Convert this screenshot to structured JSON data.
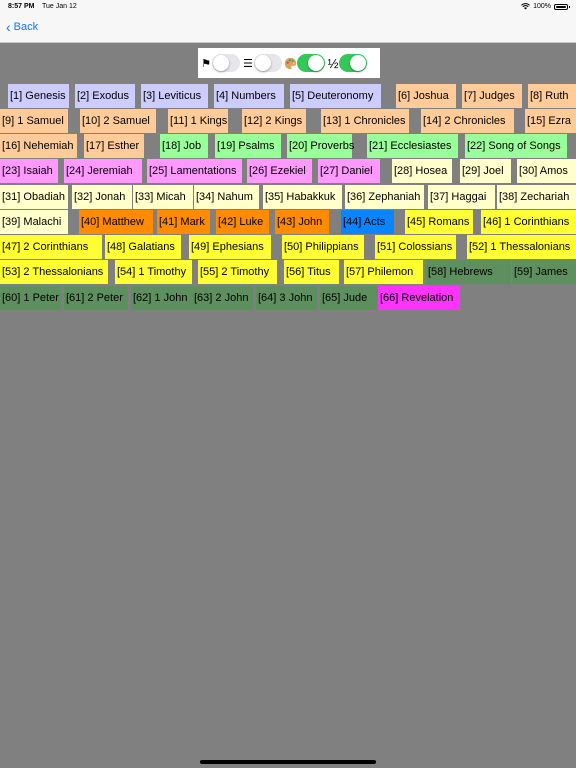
{
  "status": {
    "time": "8:57 PM",
    "date": "Tue Jan 12",
    "battery": "100%"
  },
  "nav": {
    "back_label": "Back"
  },
  "toggles": {
    "flag_glyph": "⚑",
    "list_glyph": "☰",
    "half_glyph": "½",
    "flag_on": false,
    "list_on": false,
    "palette_on": true,
    "half_on": true
  },
  "colors": {
    "law": "#ccccff",
    "history": "#ffcc99",
    "wisdom": "#99ff99",
    "prophets_major": "#ff99ff",
    "prophets_minor": "#ffffcc",
    "gospels": "#ff8c00",
    "acts": "#0a84ff",
    "epistles": "#ffff33",
    "general_epistles": "#5e8f5e",
    "revelation": "#ff33ff",
    "toggle_on": "#34c759",
    "link": "#0a7aff"
  },
  "books": [
    {
      "label": "[1] Genesis",
      "group": "law"
    },
    {
      "label": "[2] Exodus",
      "group": "law"
    },
    {
      "label": "[3] Leviticus",
      "group": "law"
    },
    {
      "label": "[4] Numbers",
      "group": "law"
    },
    {
      "label": "[5] Deuteronomy",
      "group": "law"
    },
    {
      "label": "[6] Joshua",
      "group": "history"
    },
    {
      "label": "[7] Judges",
      "group": "history"
    },
    {
      "label": "[8] Ruth",
      "group": "history"
    },
    {
      "label": "[9] 1 Samuel",
      "group": "history"
    },
    {
      "label": "[10] 2 Samuel",
      "group": "history"
    },
    {
      "label": "[11] 1 Kings",
      "group": "history"
    },
    {
      "label": "[12] 2 Kings",
      "group": "history"
    },
    {
      "label": "[13] 1 Chronicles",
      "group": "history"
    },
    {
      "label": "[14] 2 Chronicles",
      "group": "history"
    },
    {
      "label": "[15] Ezra",
      "group": "history"
    },
    {
      "label": "[16] Nehemiah",
      "group": "history"
    },
    {
      "label": "[17] Esther",
      "group": "history"
    },
    {
      "label": "[18] Job",
      "group": "wisdom"
    },
    {
      "label": "[19] Psalms",
      "group": "wisdom"
    },
    {
      "label": "[20] Proverbs",
      "group": "wisdom"
    },
    {
      "label": "[21] Ecclesiastes",
      "group": "wisdom"
    },
    {
      "label": "[22] Song of Songs",
      "group": "wisdom"
    },
    {
      "label": "[23] Isaiah",
      "group": "prophets_major"
    },
    {
      "label": "[24] Jeremiah",
      "group": "prophets_major"
    },
    {
      "label": "[25] Lamentations",
      "group": "prophets_major"
    },
    {
      "label": "[26] Ezekiel",
      "group": "prophets_major"
    },
    {
      "label": "[27] Daniel",
      "group": "prophets_major"
    },
    {
      "label": "[28] Hosea",
      "group": "prophets_minor"
    },
    {
      "label": "[29] Joel",
      "group": "prophets_minor"
    },
    {
      "label": "[30] Amos",
      "group": "prophets_minor"
    },
    {
      "label": "[31] Obadiah",
      "group": "prophets_minor"
    },
    {
      "label": "[32] Jonah",
      "group": "prophets_minor"
    },
    {
      "label": "[33] Micah",
      "group": "prophets_minor"
    },
    {
      "label": "[34] Nahum",
      "group": "prophets_minor"
    },
    {
      "label": "[35] Habakkuk",
      "group": "prophets_minor"
    },
    {
      "label": "[36] Zephaniah",
      "group": "prophets_minor"
    },
    {
      "label": "[37] Haggai",
      "group": "prophets_minor"
    },
    {
      "label": "[38] Zechariah",
      "group": "prophets_minor"
    },
    {
      "label": "[39] Malachi",
      "group": "prophets_minor"
    },
    {
      "label": "[40] Matthew",
      "group": "gospels"
    },
    {
      "label": "[41] Mark",
      "group": "gospels"
    },
    {
      "label": "[42] Luke",
      "group": "gospels"
    },
    {
      "label": "[43] John",
      "group": "gospels"
    },
    {
      "label": "[44] Acts",
      "group": "acts"
    },
    {
      "label": "[45] Romans",
      "group": "epistles"
    },
    {
      "label": "[46] 1 Corinthians",
      "group": "epistles"
    },
    {
      "label": "[47] 2 Corinthians",
      "group": "epistles"
    },
    {
      "label": "[48] Galatians",
      "group": "epistles"
    },
    {
      "label": "[49] Ephesians",
      "group": "epistles"
    },
    {
      "label": "[50] Philippians",
      "group": "epistles"
    },
    {
      "label": "[51] Colossians",
      "group": "epistles"
    },
    {
      "label": "[52] 1 Thessalonians",
      "group": "epistles"
    },
    {
      "label": "[53] 2 Thessalonians",
      "group": "epistles"
    },
    {
      "label": "[54] 1 Timothy",
      "group": "epistles"
    },
    {
      "label": "[55] 2 Timothy",
      "group": "epistles"
    },
    {
      "label": "[56] Titus",
      "group": "epistles"
    },
    {
      "label": "[57] Philemon",
      "group": "epistles"
    },
    {
      "label": "[58] Hebrews",
      "group": "general_epistles"
    },
    {
      "label": "[59] James",
      "group": "general_epistles"
    },
    {
      "label": "[60] 1 Peter",
      "group": "general_epistles"
    },
    {
      "label": "[61] 2 Peter",
      "group": "general_epistles"
    },
    {
      "label": "[62] 1 John",
      "group": "general_epistles"
    },
    {
      "label": "[63] 2 John",
      "group": "general_epistles"
    },
    {
      "label": "[64] 3 John",
      "group": "general_epistles"
    },
    {
      "label": "[65] Jude",
      "group": "general_epistles"
    },
    {
      "label": "[66] Revelation",
      "group": "revelation"
    }
  ]
}
